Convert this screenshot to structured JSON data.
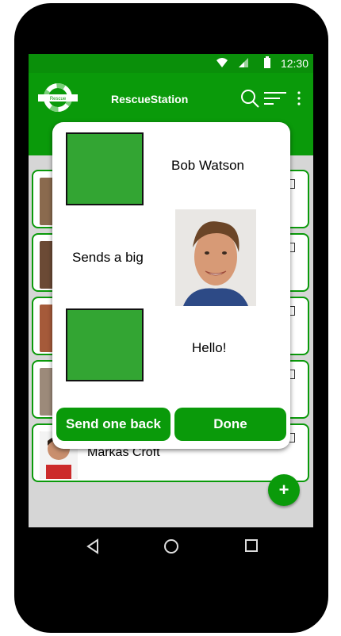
{
  "status": {
    "time": "12:30"
  },
  "appbar": {
    "title": "RescueStation",
    "logo_text": "Rescue"
  },
  "list": {
    "visible_name": "Markas Croft"
  },
  "dialog": {
    "sender_name": "Bob Watson",
    "message_line": "Sends a big",
    "message_text": "Hello!",
    "buttons": {
      "send_back": "Send one back",
      "done": "Done"
    }
  },
  "fab": {
    "label": "+"
  },
  "colors": {
    "primary": "#0a9a0a",
    "square": "#33a533",
    "statusbar": "#0a8f0a"
  }
}
